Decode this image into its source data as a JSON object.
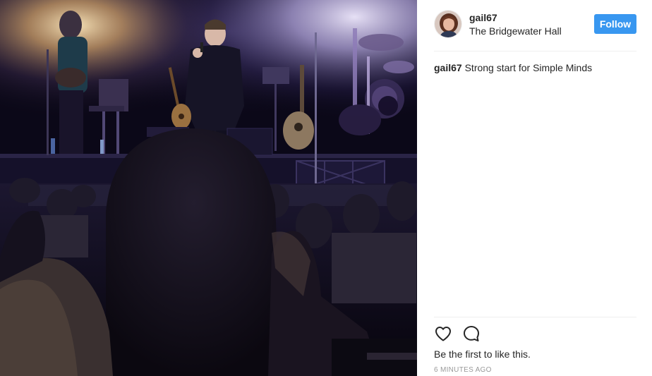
{
  "post": {
    "username": "gail67",
    "location": "The Bridgewater Hall",
    "follow_label": "Follow",
    "caption_user": "gail67",
    "caption_text": "Strong start for Simple Minds",
    "likes_text": "Be the first to like this.",
    "timestamp": "6 MINUTES AGO"
  },
  "icons": {
    "like": "heart-outline-icon",
    "comment": "speech-bubble-icon"
  },
  "colors": {
    "follow_button": "#3897f0",
    "text": "#262626",
    "muted": "#999999",
    "divider": "#efefef"
  }
}
